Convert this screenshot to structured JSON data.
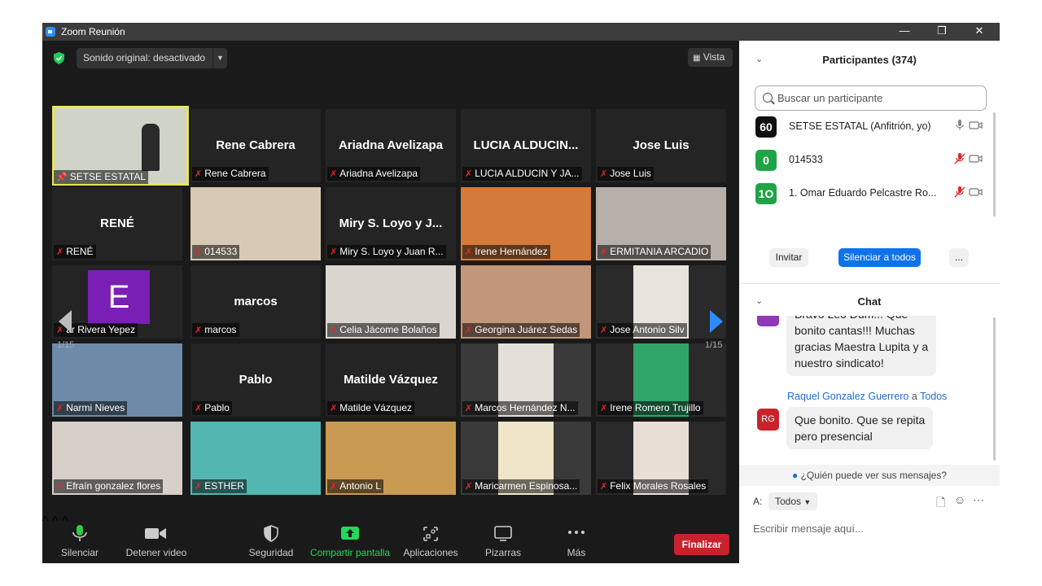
{
  "window": {
    "title": "Zoom Reunión",
    "controls": [
      "—",
      "❐",
      "✕"
    ]
  },
  "top_bar": {
    "sound": "Sonido original: desactivado",
    "view": "Vista"
  },
  "tiles": [
    {
      "name": "SETSE ESTATAL",
      "big": "",
      "pinned": true,
      "video": true
    },
    {
      "name": "Rene Cabrera",
      "big": "Rene Cabrera",
      "video": false
    },
    {
      "name": "Ariadna Avelizapa",
      "big": "Ariadna Avelizapa",
      "video": false
    },
    {
      "name": "LUCIA ALDUCIN Y JA...",
      "big": "LUCIA ALDUCIN...",
      "video": false
    },
    {
      "name": "Jose Luis",
      "big": "Jose Luis",
      "video": false
    },
    {
      "name": "RENÉ",
      "big": "RENÉ",
      "video": false
    },
    {
      "name": "014533",
      "big": "",
      "video": true
    },
    {
      "name": "Miry S. Loyo y Juan R...",
      "big": "Miry S. Loyo y J...",
      "video": false
    },
    {
      "name": "Irene Hernández",
      "big": "",
      "video": true
    },
    {
      "name": "ERMITANIA ARCADIO",
      "big": "",
      "video": true
    },
    {
      "name": "ar Rivera Yepez",
      "big": "E",
      "video": false
    },
    {
      "name": "marcos",
      "big": "marcos",
      "video": false
    },
    {
      "name": "Celia Jácome Bolaños",
      "big": "",
      "video": true
    },
    {
      "name": "Georgina Juárez Sedas",
      "big": "",
      "video": true
    },
    {
      "name": "Jose Antonio Silv",
      "big": "",
      "video": true
    },
    {
      "name": "Narmi Nieves",
      "big": "",
      "video": true
    },
    {
      "name": "Pablo",
      "big": "Pablo",
      "video": false
    },
    {
      "name": "Matilde Vázquez",
      "big": "Matilde Vázquez",
      "video": false
    },
    {
      "name": "Marcos Hernández N...",
      "big": "",
      "video": true
    },
    {
      "name": "Irene Romero Trujillo",
      "big": "",
      "video": true
    },
    {
      "name": "Efraín gonzalez flores",
      "big": "",
      "video": true
    },
    {
      "name": "ESTHER",
      "big": "",
      "video": true
    },
    {
      "name": "Antonio L",
      "big": "",
      "video": true
    },
    {
      "name": "Maricarmen Espinosa...",
      "big": "",
      "video": true
    },
    {
      "name": "Felix Morales Rosales",
      "big": "",
      "video": true
    }
  ],
  "pagination": {
    "left": "1/15",
    "right": "1/15"
  },
  "toolbar": {
    "mute": "Silenciar",
    "video": "Detener video",
    "security": "Seguridad",
    "share": "Compartir pantalla",
    "apps": "Aplicaciones",
    "whiteboard": "Pizarras",
    "more": "Más",
    "end": "Finalizar"
  },
  "participants": {
    "header": "Participantes (374)",
    "search_placeholder": "Buscar un participante",
    "list": [
      {
        "avatar": "60",
        "name": "SETSE ESTATAL (Anfitrión, yo)",
        "color": "#111111",
        "muted": false
      },
      {
        "avatar": "0",
        "name": "014533",
        "color": "#1fa346",
        "muted": true
      },
      {
        "avatar": "1O",
        "name": "1. Omar Eduardo Pelcastre Ro...",
        "color": "#1fa346",
        "muted": true
      }
    ],
    "invite": "Invitar",
    "mute_all": "Silenciar a todos",
    "more": "..."
  },
  "chat": {
    "header": "Chat",
    "msg1_partial": "Bravo Leo Dum!!! Que",
    "msg1_lines": [
      "bonito cantas!!! Muchas",
      "gracias Maestra Lupita y a",
      "nuestro sindicato!"
    ],
    "msg2_sender": "Raquel Gonzalez Guerrero",
    "msg2_to_word": "a",
    "msg2_to": "Todos",
    "msg2_avatar": "RG",
    "msg2_lines": [
      "Que bonito. Que se repita",
      "pero presencial"
    ],
    "who_can_see": "¿Quién puede ver sus mensajes?",
    "to_label": "A:",
    "to_value": "Todos",
    "input_placeholder": "Escribir mensaje aquí..."
  },
  "colors": {
    "accent": "#0e72ed",
    "end": "#c8232c",
    "share": "#23d959",
    "muted": "#e02828"
  }
}
